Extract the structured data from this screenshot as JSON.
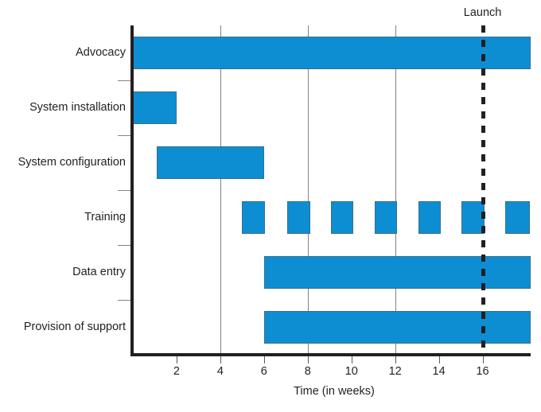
{
  "chart_data": {
    "type": "bar",
    "chart_subtype": "gantt",
    "title": "",
    "xlabel": "Time (in weeks)",
    "ylabel": "",
    "xlim": [
      0,
      18.2
    ],
    "ylim": [
      0,
      7
    ],
    "grid": "vertical gridlines at weeks 4, 8, 12",
    "xticks": [
      2,
      4,
      6,
      8,
      10,
      12,
      14,
      16
    ],
    "xticklabels": [
      "2",
      "4",
      "6",
      "8",
      "10",
      "12",
      "14",
      "16"
    ],
    "gridlines": [
      4,
      8,
      12
    ],
    "categories": [
      "Advocacy",
      "System installation",
      "System configuration",
      "Training",
      "Data entry",
      "Provision of support"
    ],
    "tasks": [
      {
        "name": "Advocacy",
        "start": 0,
        "end": 18.2,
        "segments": [
          [
            0,
            18.2
          ]
        ]
      },
      {
        "name": "System installation",
        "start": 0,
        "end": 2,
        "segments": [
          [
            0,
            2
          ]
        ]
      },
      {
        "name": "System configuration",
        "start": 1.1,
        "end": 6,
        "segments": [
          [
            1.1,
            6
          ]
        ]
      },
      {
        "name": "Training",
        "start": 5,
        "end": 18.2,
        "segments": [
          [
            5,
            6.05
          ],
          [
            7.05,
            8.1
          ],
          [
            9.05,
            10.1
          ],
          [
            11.05,
            12.1
          ],
          [
            13.05,
            14.1
          ],
          [
            15.05,
            16.1
          ],
          [
            17.05,
            18.15
          ]
        ]
      },
      {
        "name": "Data entry",
        "start": 6,
        "end": 18.2,
        "segments": [
          [
            6,
            18.2
          ]
        ]
      },
      {
        "name": "Provision of support",
        "start": 6,
        "end": 18.2,
        "segments": [
          [
            6,
            18.2
          ]
        ]
      }
    ],
    "milestones": [
      {
        "label": "Launch",
        "week": 16
      }
    ],
    "colors": {
      "bar_fill": "#0e8ed2",
      "bar_border": "#3a6d8c",
      "axis": "#231f20",
      "gridline": "#808285",
      "milestone": "#231f20",
      "text": "#231f20",
      "background": "#ffffff"
    }
  },
  "axis": {
    "x_title": "Time (in weeks)"
  },
  "milestone": {
    "label": "Launch"
  },
  "rows": [
    {
      "label": "Advocacy"
    },
    {
      "label": "System installation"
    },
    {
      "label": "System configuration"
    },
    {
      "label": "Training"
    },
    {
      "label": "Data entry"
    },
    {
      "label": "Provision of support"
    }
  ],
  "xticklabels": [
    {
      "text": "2"
    },
    {
      "text": "4"
    },
    {
      "text": "6"
    },
    {
      "text": "8"
    },
    {
      "text": "10"
    },
    {
      "text": "12"
    },
    {
      "text": "14"
    },
    {
      "text": "16"
    }
  ]
}
